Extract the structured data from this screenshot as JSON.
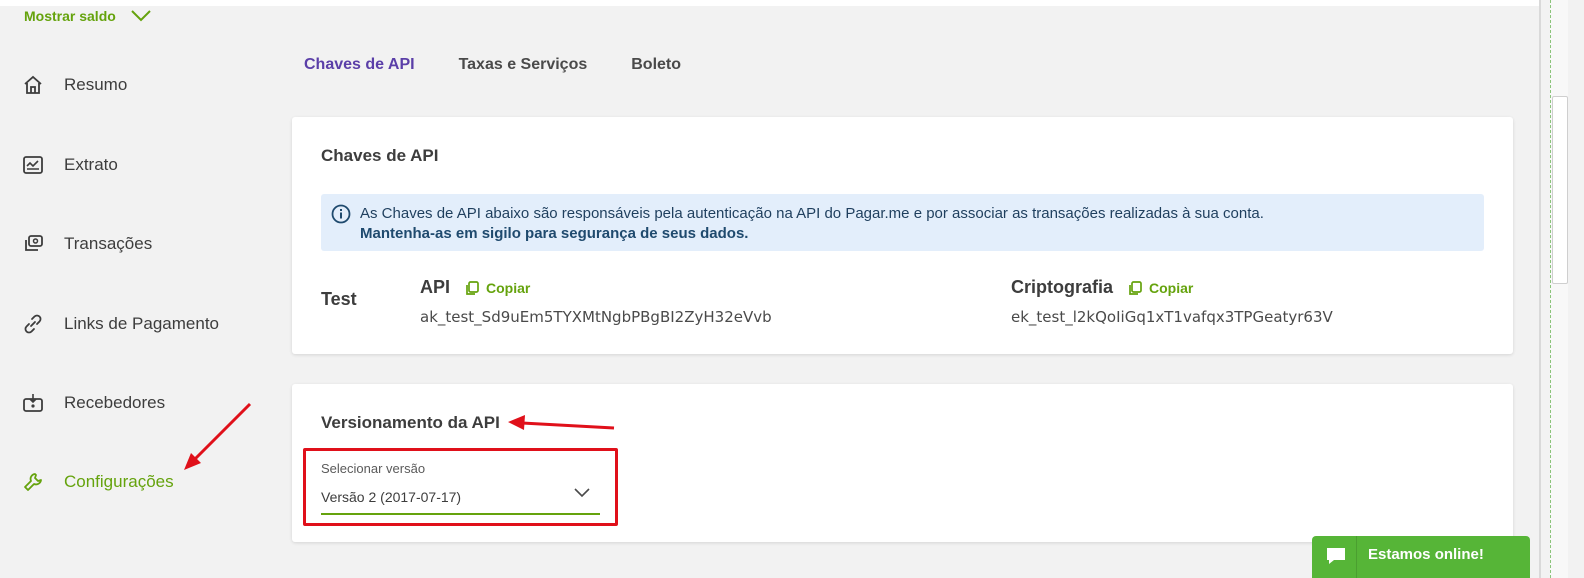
{
  "balance": {
    "label": "Mostrar saldo"
  },
  "sidebar": {
    "items": [
      {
        "label": "Resumo",
        "icon": "home-icon"
      },
      {
        "label": "Extrato",
        "icon": "statement-icon"
      },
      {
        "label": "Transações",
        "icon": "transactions-icon"
      },
      {
        "label": "Links de Pagamento",
        "icon": "link-icon"
      },
      {
        "label": "Recebedores",
        "icon": "recipients-icon"
      },
      {
        "label": "Configurações",
        "icon": "wrench-icon",
        "active": true
      }
    ]
  },
  "tabs": [
    {
      "label": "Chaves de API",
      "active": true
    },
    {
      "label": "Taxas e Serviços"
    },
    {
      "label": "Boleto"
    }
  ],
  "api_keys": {
    "title": "Chaves de API",
    "alert_text": "As Chaves de API abaixo são responsáveis pela autenticação na API do Pagar.me e por associar as transações realizadas à sua conta.",
    "alert_bold": "Mantenha-as em sigilo para segurança de seus dados.",
    "environment": "Test",
    "api_label": "API",
    "api_copy": "Copiar",
    "api_value": "ak_test_Sd9uEm5TYXMtNgbPBgBI2ZyH32eVvb",
    "crypto_label": "Criptografia",
    "crypto_copy": "Copiar",
    "crypto_value": "ek_test_l2kQoIiGq1xT1vafqx3TPGeatyr63V"
  },
  "versioning": {
    "title": "Versionamento da API",
    "select_label": "Selecionar versão",
    "select_value": "Versão 2 (2017-07-17)"
  },
  "chat": {
    "label": "Estamos online!"
  },
  "colors": {
    "accent": "#65a30d",
    "tab_active": "#5b3fa8",
    "annotation": "#e0101a",
    "chat": "#56b537"
  }
}
